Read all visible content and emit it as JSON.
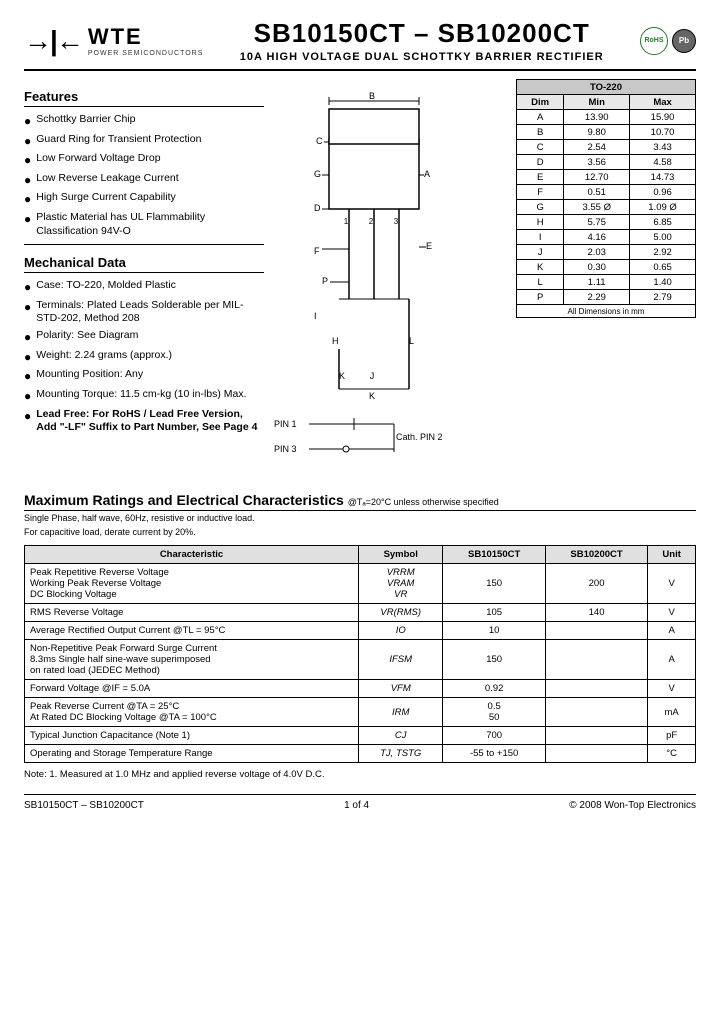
{
  "header": {
    "logo_symbol": "→|←",
    "logo_wte": "WTE",
    "logo_sub": "POWER SEMICONDUCTORS",
    "part_number": "SB10150CT – SB10200CT",
    "subtitle": "10A HIGH VOLTAGE DUAL SCHOTTKY BARRIER RECTIFIER",
    "badge_rohs": "RoHS",
    "badge_pb": "Pb"
  },
  "features": {
    "title": "Features",
    "items": [
      "Schottky Barrier Chip",
      "Guard Ring for Transient Protection",
      "Low Forward Voltage Drop",
      "Low Reverse Leakage Current",
      "High Surge Current Capability",
      "Plastic Material has UL Flammability Classification 94V-O"
    ]
  },
  "mechanical": {
    "title": "Mechanical Data",
    "items": [
      "Case: TO-220, Molded Plastic",
      "Terminals: Plated Leads Solderable per MIL-STD-202, Method 208",
      "Polarity: See Diagram",
      "Weight: 2.24 grams (approx.)",
      "Mounting Position: Any",
      "Mounting Torque: 11.5 cm-kg (10 in-lbs) Max.",
      "Lead Free: For RoHS / Lead Free Version, Add \"-LF\" Suffix to Part Number, See Page 4"
    ],
    "bold_last": true
  },
  "dimensions": {
    "title": "TO-220",
    "headers": [
      "Dim",
      "Min",
      "Max"
    ],
    "rows": [
      [
        "A",
        "13.90",
        "15.90"
      ],
      [
        "B",
        "9.80",
        "10.70"
      ],
      [
        "C",
        "2.54",
        "3.43"
      ],
      [
        "D",
        "3.56",
        "4.58"
      ],
      [
        "E",
        "12.70",
        "14.73"
      ],
      [
        "F",
        "0.51",
        "0.96"
      ],
      [
        "G",
        "3.55 Ø",
        "1.09 Ø"
      ],
      [
        "H",
        "5.75",
        "6.85"
      ],
      [
        "I",
        "4.16",
        "5.00"
      ],
      [
        "J",
        "2.03",
        "2.92"
      ],
      [
        "K",
        "0.30",
        "0.65"
      ],
      [
        "L",
        "1.11",
        "1.40"
      ],
      [
        "P",
        "2.29",
        "2.79"
      ]
    ],
    "footer": "All Dimensions in mm"
  },
  "max_ratings": {
    "title": "Maximum Ratings and Electrical Characteristics",
    "condition": "@Tₐ=20°C unless otherwise specified",
    "notes_line1": "Single Phase, half wave, 60Hz, resistive or inductive load.",
    "notes_line2": "For capacitive load, derate current by 20%.",
    "table_headers": [
      "Characteristic",
      "Symbol",
      "SB10150CT",
      "SB10200CT",
      "Unit"
    ],
    "rows": [
      {
        "char": "Peak Repetitive Reverse Voltage\nWorking Peak Reverse Voltage\nDC Blocking Voltage",
        "symbol": "VRRM\nVRAM\nVR",
        "val1": "150",
        "val2": "200",
        "unit": "V"
      },
      {
        "char": "RMS Reverse Voltage",
        "symbol": "VR(RMS)",
        "val1": "105",
        "val2": "140",
        "unit": "V"
      },
      {
        "char": "Average Rectified Output Current    @TL = 95°C",
        "symbol": "IO",
        "val1": "10",
        "val2": "",
        "unit": "A"
      },
      {
        "char": "Non-Repetitive Peak Forward Surge Current\n8.3ms Single half sine-wave superimposed\non rated load (JEDEC Method)",
        "symbol": "IFSM",
        "val1": "150",
        "val2": "",
        "unit": "A"
      },
      {
        "char": "Forward Voltage    @IF = 5.0A",
        "symbol": "VFM",
        "val1": "0.92",
        "val2": "",
        "unit": "V"
      },
      {
        "char": "Peak Reverse Current    @TA = 25°C\nAt Rated DC Blocking Voltage    @TA = 100°C",
        "symbol": "IRM",
        "val1": "0.5\n50",
        "val2": "",
        "unit": "mA"
      },
      {
        "char": "Typical Junction Capacitance (Note 1)",
        "symbol": "CJ",
        "val1": "700",
        "val2": "",
        "unit": "pF"
      },
      {
        "char": "Operating and Storage Temperature Range",
        "symbol": "TJ, TSTG",
        "val1": "-55 to +150",
        "val2": "",
        "unit": "°C"
      }
    ]
  },
  "note": "Note:  1. Measured at 1.0 MHz and applied reverse voltage of 4.0V D.C.",
  "footer": {
    "left": "SB10150CT – SB10200CT",
    "center": "1 of 4",
    "right": "© 2008 Won-Top Electronics"
  }
}
